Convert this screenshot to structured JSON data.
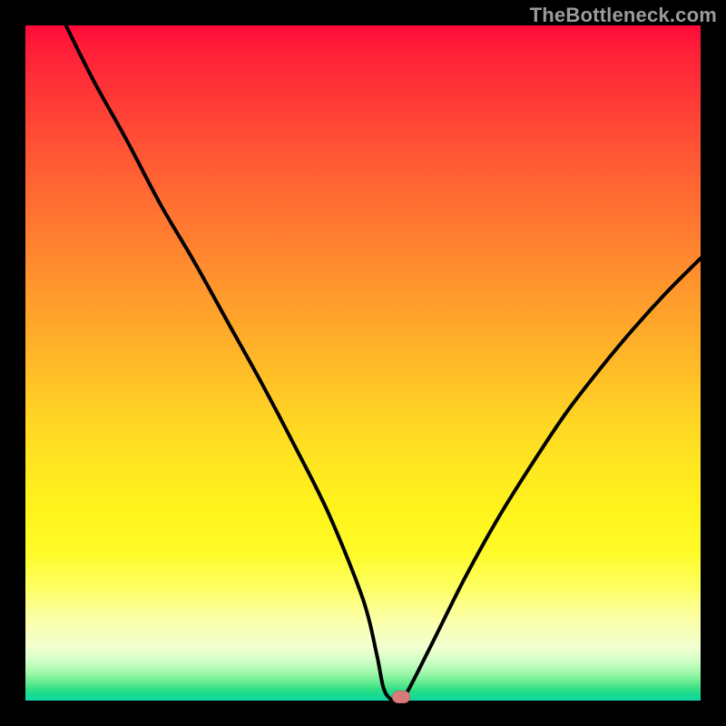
{
  "watermark": "TheBottleneck.com",
  "colors": {
    "frame": "#000000",
    "curve": "#000000",
    "marker": "#d67a7a"
  },
  "chart_data": {
    "type": "line",
    "title": "",
    "xlabel": "",
    "ylabel": "",
    "xlim": [
      0,
      100
    ],
    "ylim": [
      0,
      100
    ],
    "grid": false,
    "legend": false,
    "description": "Bottleneck curve showing mismatch percentage falling to a flat minimum around x≈54 then rising again, over a vertical red-to-green gradient background.",
    "series": [
      {
        "name": "bottleneck-curve",
        "x": [
          6,
          10,
          15,
          20,
          25,
          30,
          35,
          40,
          45,
          50,
          52,
          53,
          54,
          55,
          56,
          60,
          65,
          70,
          75,
          80,
          85,
          90,
          95,
          100
        ],
        "y": [
          100,
          92,
          83,
          73.5,
          65,
          56,
          47,
          37.5,
          27.5,
          15,
          7,
          2,
          0.3,
          0.3,
          0.3,
          8,
          18,
          27,
          35,
          42.5,
          49,
          55,
          60.5,
          65.5
        ]
      }
    ],
    "marker": {
      "x": 55.6,
      "y": 0.5
    },
    "gradient_stops": [
      {
        "pct": 0,
        "color": "#ff0a3a"
      },
      {
        "pct": 50,
        "color": "#ffb928"
      },
      {
        "pct": 80,
        "color": "#fdff5e"
      },
      {
        "pct": 100,
        "color": "#14d5a6"
      }
    ]
  }
}
